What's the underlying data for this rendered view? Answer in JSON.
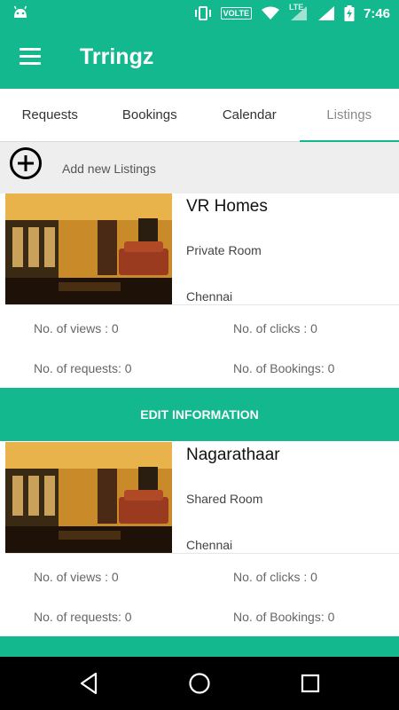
{
  "status_bar": {
    "volte": "VOLTE",
    "lte": "LTE",
    "time": "7:46"
  },
  "app": {
    "title": "Trringz"
  },
  "tabs": [
    {
      "label": "Requests",
      "active": false
    },
    {
      "label": "Bookings",
      "active": false
    },
    {
      "label": "Calendar",
      "active": false
    },
    {
      "label": "Listings",
      "active": true
    }
  ],
  "add_listing": {
    "label": "Add new Listings",
    "icon": "add-circle-icon"
  },
  "listings": [
    {
      "name": "VR Homes",
      "type": "Private Room",
      "city": "Chennai",
      "views": "No. of views : 0",
      "clicks": "No. of clicks : 0",
      "requests": "No. of requests: 0",
      "bookings": "No. of Bookings: 0",
      "edit_label": "EDIT INFORMATION"
    },
    {
      "name": "Nagarathaar",
      "type": "Shared Room",
      "city": "Chennai",
      "views": "No. of views : 0",
      "clicks": "No. of clicks : 0",
      "requests": "No. of requests: 0",
      "bookings": "No. of Bookings: 0",
      "edit_label": ""
    }
  ],
  "colors": {
    "primary": "#14b88f",
    "background": "#ffffff",
    "add_row_bg": "#eeeeee"
  }
}
